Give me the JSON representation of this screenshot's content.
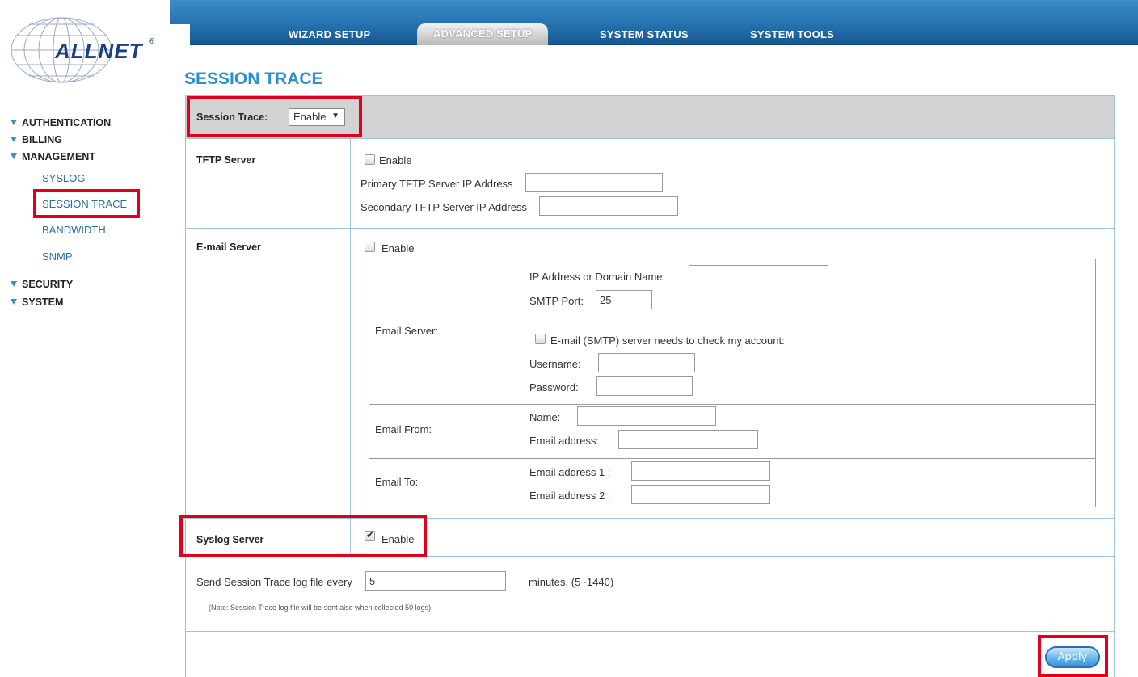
{
  "logo": {
    "text": "ALLNET",
    "reg": "®"
  },
  "top_nav": [
    {
      "label": "WIZARD SETUP"
    },
    {
      "label": "ADVANCED SETUP",
      "active": true
    },
    {
      "label": "SYSTEM STATUS"
    },
    {
      "label": "SYSTEM TOOLS"
    }
  ],
  "sidebar": {
    "authentication": "AUTHENTICATION",
    "billing": "BILLING",
    "management": "MANAGEMENT",
    "syslog": "SYSLOG",
    "session_trace": "SESSION TRACE",
    "bandwidth": "BANDWIDTH",
    "snmp": "SNMP",
    "security": "SECURITY",
    "system": "SYSTEM"
  },
  "page_title": "SESSION TRACE",
  "session_trace": {
    "label": "Session Trace:",
    "value": "Enable"
  },
  "tftp": {
    "label": "TFTP Server",
    "enable": "Enable",
    "primary_label": "Primary TFTP Server IP Address",
    "primary_value": "",
    "secondary_label": "Secondary TFTP Server IP Address",
    "secondary_value": ""
  },
  "email": {
    "label": "E-mail Server",
    "enable": "Enable",
    "server_label": "Email Server:",
    "ip_label": "IP Address or Domain Name:",
    "ip_value": "",
    "smtp_port_label": "SMTP Port:",
    "smtp_port_value": "25",
    "check_account_label": "E-mail (SMTP) server needs to check my account:",
    "username_label": "Username:",
    "username_value": "",
    "password_label": "Password:",
    "password_value": "",
    "from_label": "Email From:",
    "from_name_label": "Name:",
    "from_name_value": "",
    "from_addr_label": "Email address:",
    "from_addr_value": "",
    "to_label": "Email To:",
    "to_addr1_label": "Email address 1 :",
    "to_addr1_value": "",
    "to_addr2_label": "Email address 2 :",
    "to_addr2_value": ""
  },
  "syslog": {
    "label": "Syslog Server",
    "enable": "Enable",
    "checked": true
  },
  "interval": {
    "prefix": "Send Session Trace log file every",
    "value": "5",
    "suffix": "minutes. (5~1440)",
    "note": "(Note: Session Trace log file will be sent also when collected 50 logs)"
  },
  "apply_label": "Apply",
  "colors": {
    "accent": "#2b8fd1",
    "topbar": "#1f6aa7",
    "highlight": "#e0001b"
  }
}
